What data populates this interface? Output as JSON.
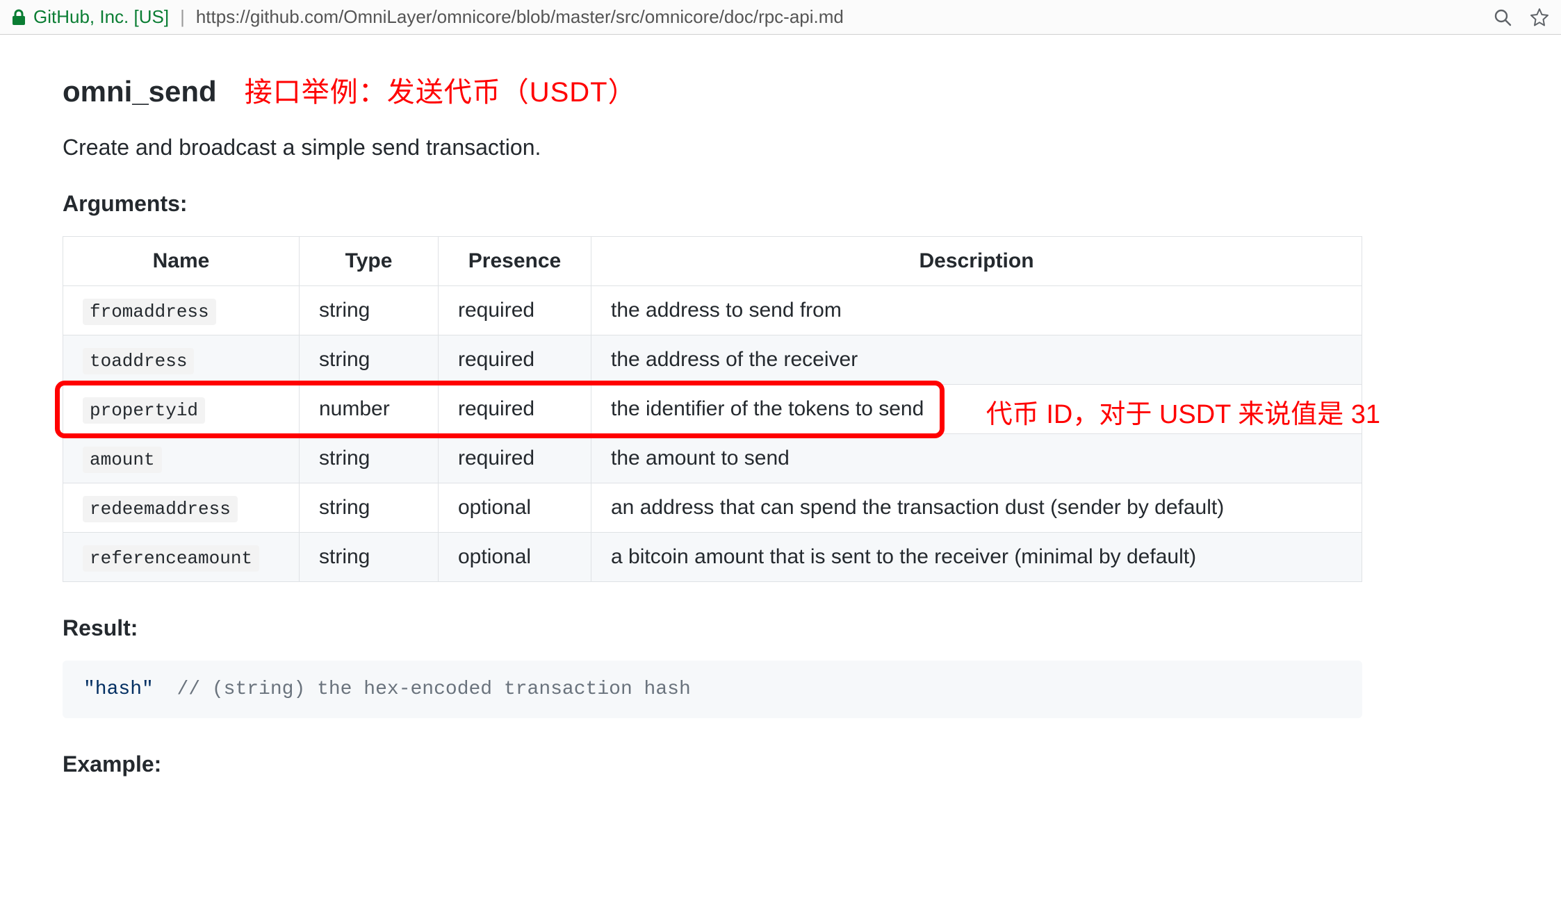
{
  "browser": {
    "site_identity": "GitHub, Inc. [US]",
    "url": "https://github.com/OmniLayer/omnicore/blob/master/src/omnicore/doc/rpc-api.md"
  },
  "heading": {
    "func_name": "omni_send",
    "title_annotation": "接口举例：发送代币（USDT）"
  },
  "description": "Create and broadcast a simple send transaction.",
  "sections": {
    "arguments_label": "Arguments:",
    "result_label": "Result:",
    "example_label": "Example:"
  },
  "table": {
    "headers": {
      "name": "Name",
      "type": "Type",
      "presence": "Presence",
      "description": "Description"
    },
    "rows": [
      {
        "name": "fromaddress",
        "type": "string",
        "presence": "required",
        "description": "the address to send from"
      },
      {
        "name": "toaddress",
        "type": "string",
        "presence": "required",
        "description": "the address of the receiver"
      },
      {
        "name": "propertyid",
        "type": "number",
        "presence": "required",
        "description": "the identifier of the tokens to send"
      },
      {
        "name": "amount",
        "type": "string",
        "presence": "required",
        "description": "the amount to send"
      },
      {
        "name": "redeemaddress",
        "type": "string",
        "presence": "optional",
        "description": "an address that can spend the transaction dust (sender by default)"
      },
      {
        "name": "referenceamount",
        "type": "string",
        "presence": "optional",
        "description": "a bitcoin amount that is sent to the receiver (minimal by default)"
      }
    ],
    "highlight_row_index": 2,
    "highlight_annotation": "代币 ID，对于 USDT 来说值是 31"
  },
  "result_code": {
    "hash_literal": "\"hash\"",
    "comment": "// (string) the hex-encoded transaction hash"
  },
  "colors": {
    "annotation_red": "#ff0000",
    "site_green": "#0a7d33"
  }
}
